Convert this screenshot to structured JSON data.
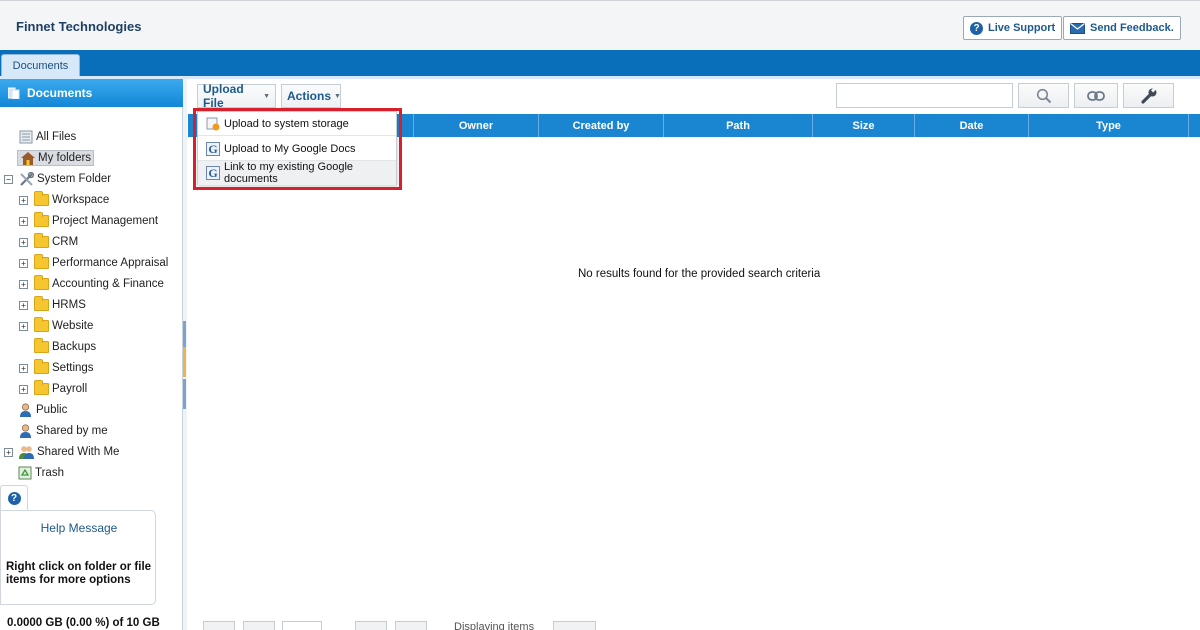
{
  "header": {
    "company": "Finnet Technologies",
    "live_support": "Live Support",
    "send_feedback": "Send Feedback."
  },
  "tabs": [
    {
      "label": "Documents",
      "active": true
    }
  ],
  "sidebar": {
    "title": "Documents",
    "tree": [
      {
        "label": "All Files",
        "icon": "all-files-icon",
        "expandable": false
      },
      {
        "label": "My folders",
        "icon": "home-icon",
        "expandable": false,
        "selected": true
      },
      {
        "label": "System Folder",
        "icon": "tools-icon",
        "expandable": true,
        "expanded": true
      },
      {
        "label": "Workspace",
        "icon": "folder-icon",
        "expandable": true
      },
      {
        "label": "Project Management",
        "icon": "folder-icon",
        "expandable": true
      },
      {
        "label": "CRM",
        "icon": "folder-icon",
        "expandable": true
      },
      {
        "label": "Performance Appraisal",
        "icon": "folder-icon",
        "expandable": true
      },
      {
        "label": "Accounting & Finance",
        "icon": "folder-icon",
        "expandable": true
      },
      {
        "label": "HRMS",
        "icon": "folder-icon",
        "expandable": true
      },
      {
        "label": "Website",
        "icon": "folder-icon",
        "expandable": true
      },
      {
        "label": "Backups",
        "icon": "folder-icon",
        "expandable": false
      },
      {
        "label": "Settings",
        "icon": "folder-icon",
        "expandable": true
      },
      {
        "label": "Payroll",
        "icon": "folder-icon",
        "expandable": true
      },
      {
        "label": "Public",
        "icon": "user-icon",
        "expandable": false
      },
      {
        "label": "Shared by me",
        "icon": "user-icon",
        "expandable": false
      },
      {
        "label": "Shared With Me",
        "icon": "users-icon",
        "expandable": true
      },
      {
        "label": "Trash",
        "icon": "trash-icon",
        "expandable": false
      }
    ],
    "help_title": "Help Message",
    "help_text": "Right click on folder or file items for more options",
    "quota": "0.0000 GB (0.00 %) of 10 GB"
  },
  "toolbar": {
    "upload_label": "Upload File",
    "actions_label": "Actions",
    "search_placeholder": ""
  },
  "upload_menu": {
    "items": [
      {
        "label": "Upload to system storage",
        "icon": "upload-storage-icon"
      },
      {
        "label": "Upload to My Google Docs",
        "icon": "google-icon"
      },
      {
        "label": "Link to my existing Google documents",
        "icon": "google-icon"
      }
    ]
  },
  "grid": {
    "columns": [
      "",
      "Owner",
      "Created by",
      "Path",
      "Size",
      "Date",
      "Type"
    ],
    "empty_message": "No results found for the provided search criteria"
  },
  "pager": {
    "display_text": "Displaying items"
  },
  "colors": {
    "primary_blue": "#0a6fba",
    "grid_header": "#1a86d2",
    "highlight_red": "#d6202e",
    "folder_yellow": "#f6c631"
  }
}
